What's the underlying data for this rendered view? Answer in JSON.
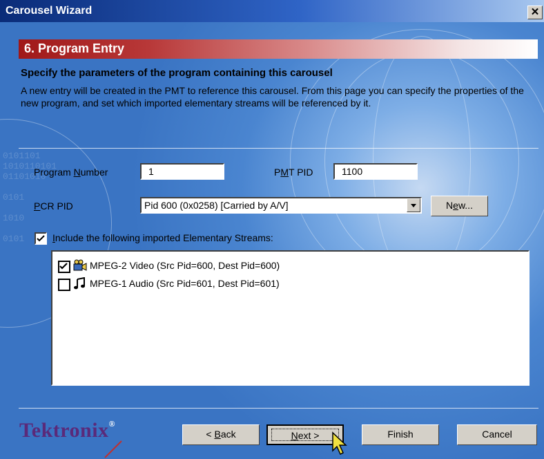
{
  "window": {
    "title": "Carousel Wizard",
    "close_glyph": "✕"
  },
  "banner": {
    "title": "6. Program Entry"
  },
  "header": {
    "subtitle": "Specify the parameters of the program containing this carousel",
    "description": "A new entry will be created in the PMT to reference this carousel. From this page you can specify the properties of the new program, and set which imported elementary streams will be referenced by it."
  },
  "form": {
    "program_number": {
      "label_pre": "Program ",
      "label_ul": "N",
      "label_post": "umber",
      "value": "1"
    },
    "pmt_pid": {
      "label_pre": "P",
      "label_ul": "M",
      "label_post": "T PID",
      "value": "1100"
    },
    "pcr_pid": {
      "label_pre": "",
      "label_ul": "P",
      "label_post": "CR PID",
      "value": "Pid 600 (0x0258) [Carried by A/V]"
    },
    "new_button": {
      "label_pre": "N",
      "label_ul": "e",
      "label_post": "w..."
    },
    "include_streams": {
      "checked": true,
      "label_pre": "",
      "label_ul": "I",
      "label_post": "nclude the following imported Elementary Streams:"
    }
  },
  "streams": [
    {
      "checked": true,
      "icon": "video-icon",
      "label": "MPEG-2 Video (Src Pid=600, Dest Pid=600)"
    },
    {
      "checked": false,
      "icon": "music-note-icon",
      "label": "MPEG-1 Audio (Src Pid=601, Dest Pid=601)"
    }
  ],
  "footer": {
    "brand": "Tektronix",
    "brand_mark": "®",
    "back_button": {
      "prefix": "< ",
      "ul": "B",
      "post": "ack"
    },
    "next_button": {
      "pre": "",
      "ul": "N",
      "post": "ext >"
    },
    "finish_button": "Finish",
    "cancel_button": "Cancel"
  },
  "colors": {
    "banner_red": "#a01818",
    "background_blue": "#4a85d0",
    "brand_purple": "#5a2a7a"
  }
}
